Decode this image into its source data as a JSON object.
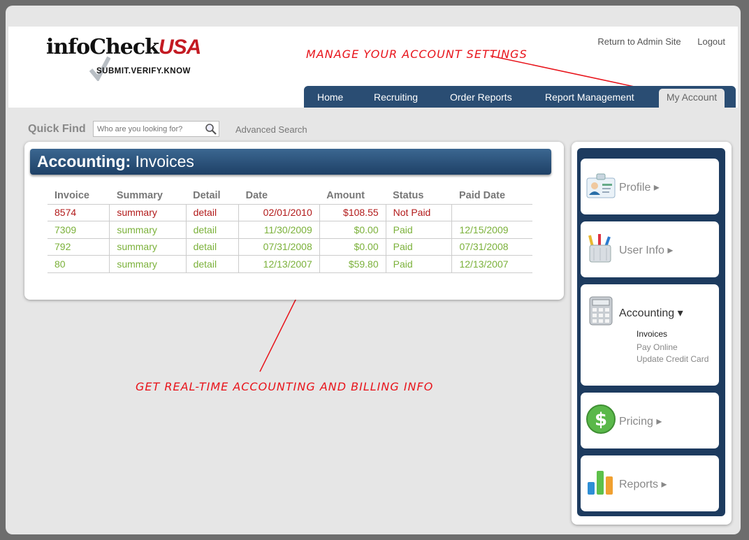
{
  "logo": {
    "word_main": "infoCheck",
    "word_accent": "USA",
    "tagline": "SUBMIT.VERIFY.KNOW"
  },
  "top_links": {
    "admin": "Return to Admin Site",
    "logout": "Logout"
  },
  "annotations": {
    "account_settings": "Manage your account settings",
    "accounting": "Get real-time accounting and billing info"
  },
  "nav": {
    "items": [
      "Home",
      "Recruiting",
      "Order Reports",
      "Report Management"
    ],
    "active": "My Account"
  },
  "quick_find": {
    "label": "Quick Find",
    "placeholder": "Who are you looking for?",
    "advanced": "Advanced Search"
  },
  "panel": {
    "title_bold": "Accounting:",
    "title_rest": "Invoices"
  },
  "invoices": {
    "headers": [
      "Invoice",
      "Summary",
      "Detail",
      "Date",
      "Amount",
      "Status",
      "Paid Date"
    ],
    "rows": [
      [
        "8574",
        "summary",
        "detail",
        "02/01/2010",
        "$108.55",
        "Not Paid",
        ""
      ],
      [
        "7309",
        "summary",
        "detail",
        "11/30/2009",
        "$0.00",
        "Paid",
        "12/15/2009"
      ],
      [
        "792",
        "summary",
        "detail",
        "07/31/2008",
        "$0.00",
        "Paid",
        "07/31/2008"
      ],
      [
        "80",
        "summary",
        "detail",
        "12/13/2007",
        "$59.80",
        "Paid",
        "12/13/2007"
      ]
    ],
    "status_colors": {
      "unpaid": "#b21a1a",
      "paid": "#7bb13a"
    }
  },
  "sidebar": {
    "profile": "Profile ▸",
    "user_info": "User Info ▸",
    "accounting": "Accounting ▾",
    "accounting_sub": [
      "Invoices",
      "Pay Online",
      "Update Credit Card"
    ],
    "pricing": "Pricing ▸",
    "reports": "Reports ▸"
  },
  "colors": {
    "nav_bg": "#2a4d73",
    "annotation": "#e8141b"
  }
}
